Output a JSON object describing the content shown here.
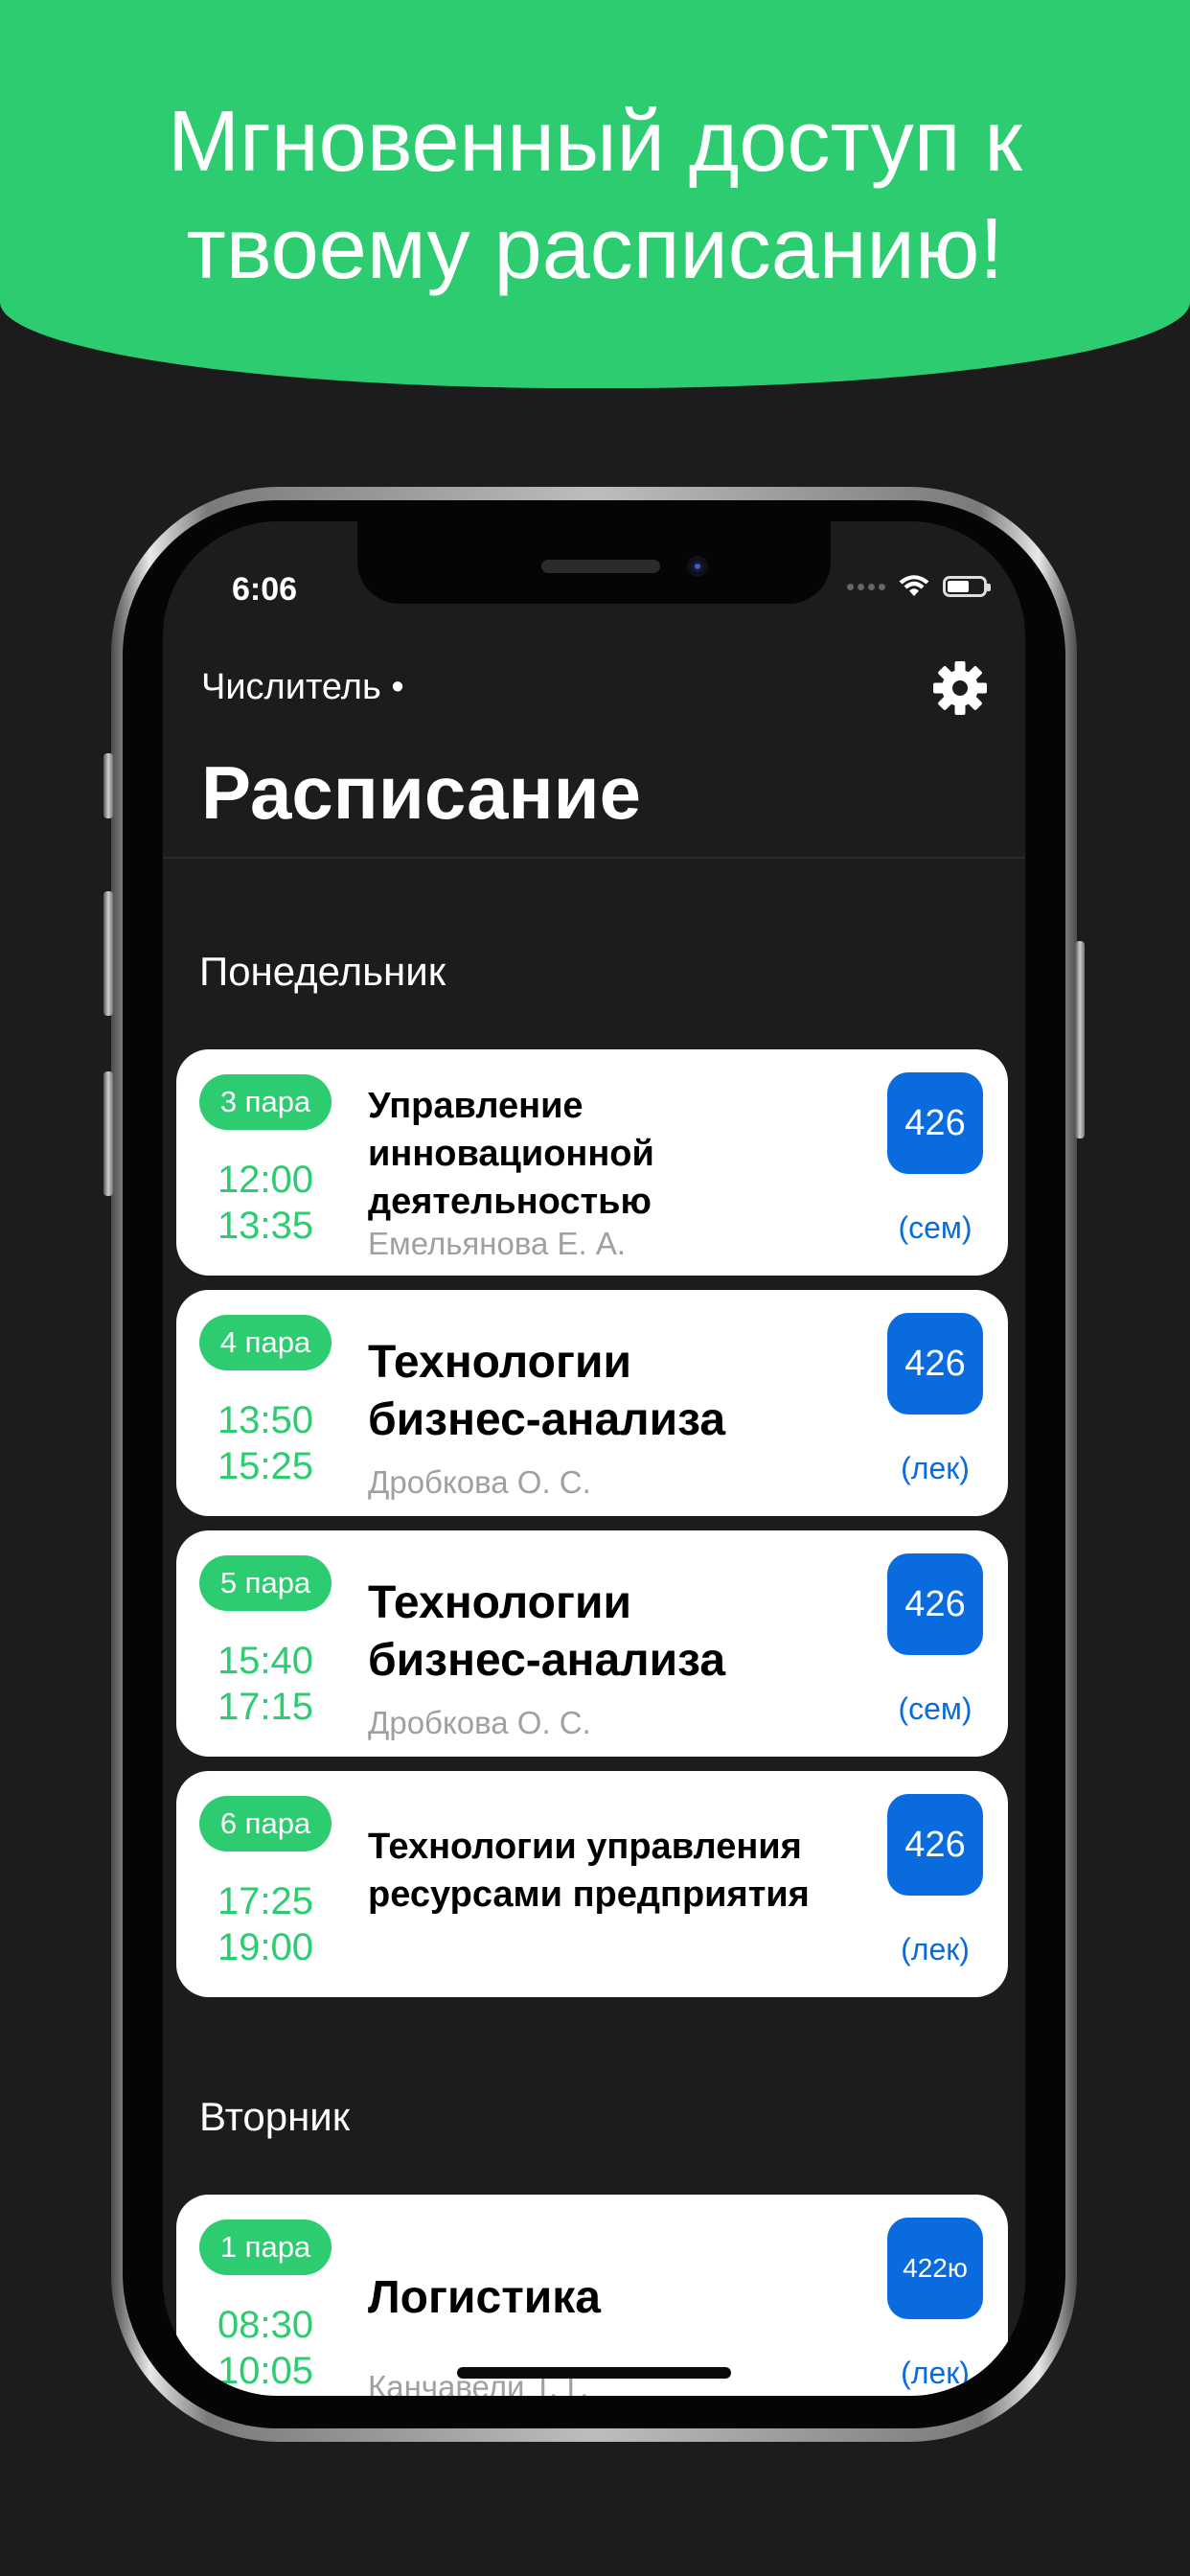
{
  "banner": {
    "line1": "Мгновенный доступ к",
    "line2": "твоему расписанию!"
  },
  "status_bar": {
    "time": "6:06"
  },
  "header": {
    "week": "Числитель •",
    "title": "Расписание"
  },
  "days": [
    {
      "name": "Понедельник",
      "lessons": [
        {
          "pair": "3 пара",
          "start": "12:00",
          "end": "13:35",
          "subject": "Управление инновационной деятельностью",
          "teacher": "Емельянова Е. А.",
          "room": "426",
          "type": "(сем)"
        },
        {
          "pair": "4 пара",
          "start": "13:50",
          "end": "15:25",
          "subject": "Технологии бизнес-анализа",
          "teacher": "Дробкова О. С.",
          "room": "426",
          "type": "(лек)"
        },
        {
          "pair": "5 пара",
          "start": "15:40",
          "end": "17:15",
          "subject": "Технологии бизнес-анализа",
          "teacher": "Дробкова О. С.",
          "room": "426",
          "type": "(сем)"
        },
        {
          "pair": "6 пара",
          "start": "17:25",
          "end": "19:00",
          "subject": "Технологии управления ресурсами предприятия",
          "teacher": "",
          "room": "426",
          "type": "(лек)"
        }
      ]
    },
    {
      "name": "Вторник",
      "lessons": [
        {
          "pair": "1 пара",
          "start": "08:30",
          "end": "10:05",
          "subject": "Логистика",
          "teacher": "Канчавели Т. Г.",
          "room": "422ю",
          "type": "(лек)"
        }
      ]
    }
  ],
  "colors": {
    "accent_green": "#2ecc71",
    "accent_blue": "#0a6bde",
    "background": "#1c1c1c"
  },
  "icons": {
    "settings": "gear-icon",
    "wifi": "wifi-icon",
    "battery": "battery-icon"
  }
}
